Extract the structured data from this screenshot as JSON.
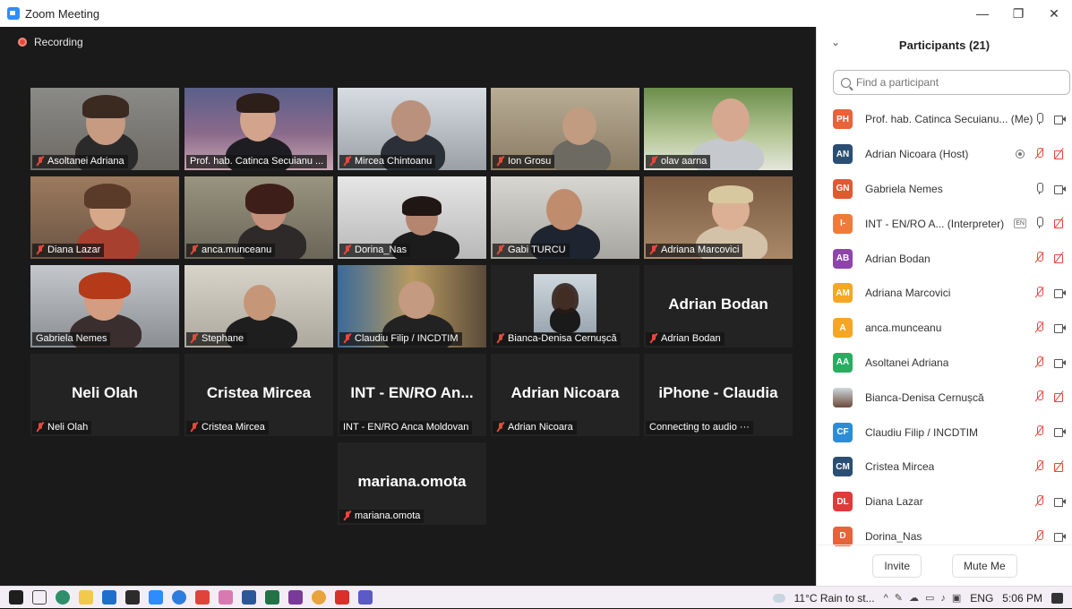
{
  "window": {
    "title": "Zoom Meeting",
    "controls": {
      "minimize": "—",
      "restore": "❐",
      "close": "✕"
    }
  },
  "recording": {
    "label": "Recording"
  },
  "tiles": [
    {
      "name": "Asoltanei Adriana",
      "muted": true
    },
    {
      "name": "Prof. hab. Catinca Secuianu ...",
      "muted": false
    },
    {
      "name": "Mircea Chintoanu",
      "muted": true
    },
    {
      "name": "Ion Grosu",
      "muted": true
    },
    {
      "name": "olav aarna",
      "muted": true
    },
    {
      "name": "Diana Lazar",
      "muted": true
    },
    {
      "name": "anca.munceanu",
      "muted": true
    },
    {
      "name": "Dorina_Nas",
      "muted": true
    },
    {
      "name": "Gabi TURCU",
      "muted": true
    },
    {
      "name": "Adriana Marcovici",
      "muted": true
    },
    {
      "name": "Gabriela Nemes",
      "muted": false
    },
    {
      "name": "Stephane",
      "muted": true
    },
    {
      "name": "Claudiu Filip / INCDTIM",
      "muted": true
    },
    {
      "name": "Bianca-Denisa Cernușcă",
      "muted": true
    },
    {
      "name": "Adrian Bodan",
      "big": "Adrian Bodan",
      "muted": true
    },
    {
      "name": "Neli Olah",
      "big": "Neli Olah",
      "muted": true
    },
    {
      "name": "Cristea Mircea",
      "big": "Cristea Mircea",
      "muted": true
    },
    {
      "name": "INT - EN/RO Anca Moldovan",
      "big": "INT - EN/RO An...",
      "muted": false
    },
    {
      "name": "Adrian Nicoara",
      "big": "Adrian Nicoara",
      "muted": true
    },
    {
      "name": "Connecting to audio ···",
      "big": "iPhone - Claudia",
      "muted": false
    },
    {
      "name": "mariana.omota",
      "big": "mariana.omota",
      "muted": true
    }
  ],
  "participants_panel": {
    "title": "Participants (21)",
    "search_placeholder": "Find a participant",
    "participants": [
      {
        "initials": "PH",
        "name": "Prof. hab. Catinca Secuianu... (Me)",
        "color": "#e8623a",
        "mic": "on",
        "cam": "on"
      },
      {
        "initials": "AN",
        "name": "Adrian Nicoara (Host)",
        "color": "#2b4e73",
        "mic": "off",
        "cam": "off",
        "recording": true
      },
      {
        "initials": "GN",
        "name": "Gabriela Nemes",
        "color": "#e05a30",
        "mic": "on",
        "cam": "on"
      },
      {
        "initials": "I-",
        "name": "INT - EN/RO A...  (Interpreter)",
        "color": "#f07a3a",
        "mic": "on",
        "cam": "off",
        "lang": "EN"
      },
      {
        "initials": "AB",
        "name": "Adrian Bodan",
        "color": "#8e44ad",
        "mic": "off",
        "cam": "off"
      },
      {
        "initials": "AM",
        "name": "Adriana Marcovici",
        "color": "#f5a623",
        "mic": "off",
        "cam": "on"
      },
      {
        "initials": "A",
        "name": "anca.munceanu",
        "color": "#f5a623",
        "mic": "off",
        "cam": "on"
      },
      {
        "initials": "AA",
        "name": "Asoltanei Adriana",
        "color": "#27ae60",
        "mic": "off",
        "cam": "on"
      },
      {
        "initials": "",
        "name": "Bianca-Denisa Cernușcă",
        "color": "#6b4a3a",
        "mic": "off",
        "cam": "off",
        "photo": true
      },
      {
        "initials": "CF",
        "name": "Claudiu Filip / INCDTIM",
        "color": "#2d8cd6",
        "mic": "off",
        "cam": "on"
      },
      {
        "initials": "CM",
        "name": "Cristea Mircea",
        "color": "#2b4e73",
        "mic": "off",
        "cam": "off"
      },
      {
        "initials": "DL",
        "name": "Diana Lazar",
        "color": "#e03a3a",
        "mic": "off",
        "cam": "on"
      },
      {
        "initials": "D",
        "name": "Dorina_Nas",
        "color": "#e8623a",
        "mic": "off",
        "cam": "on"
      }
    ],
    "invite_label": "Invite",
    "mute_me_label": "Mute Me"
  },
  "taskbar": {
    "weather": "11°C  Rain to st...",
    "language": "ENG",
    "time": "5:06 PM",
    "tray_caret": "^"
  }
}
